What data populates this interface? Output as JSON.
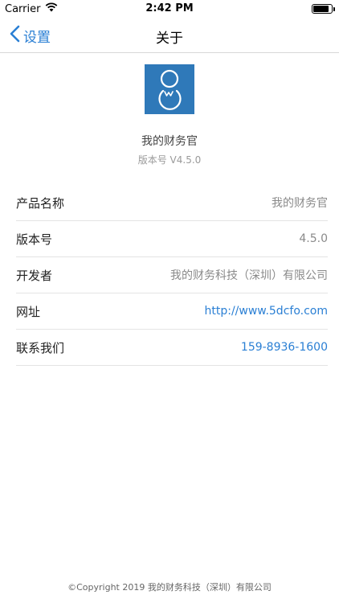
{
  "status_bar": {
    "carrier": "Carrier",
    "time": "2:42 PM",
    "battery_level": 0.85,
    "icons": [
      "wifi-icon",
      "battery-icon"
    ]
  },
  "nav": {
    "back_label": "设置",
    "title": "关于",
    "back_icon": "chevron-left-icon",
    "accent": "#2a7fd4"
  },
  "app": {
    "logo_icon": "app-logo-icon",
    "logo_color": "#2f79b9",
    "name": "我的财务官",
    "version": "版本号 V4.5.0"
  },
  "info": {
    "items": [
      {
        "label": "产品名称",
        "value": "我的财务官"
      },
      {
        "label": "版本号",
        "value": "4.5.0"
      },
      {
        "label": "开发者",
        "value": "我的财务科技（深圳）有限公司"
      },
      {
        "label": "网址",
        "value": "http://www.5dcfo.com"
      },
      {
        "label": "联系我们",
        "value": "159-8936-1600"
      }
    ]
  },
  "footer": {
    "copyright": "©Copyright 2019 我的财务科技（深圳）有限公司"
  }
}
